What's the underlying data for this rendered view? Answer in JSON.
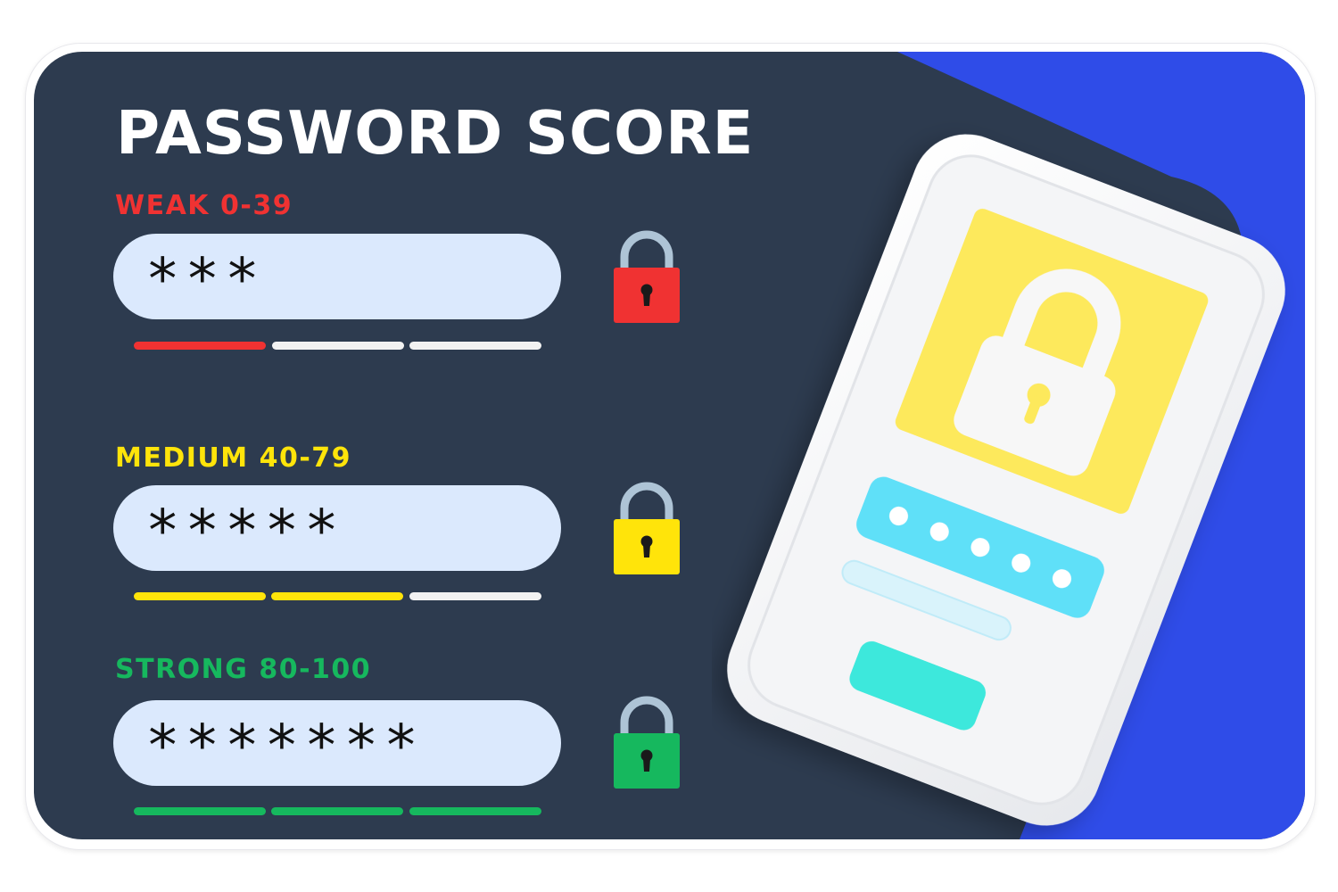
{
  "title": "PASSWORD SCORE",
  "colors": {
    "background": "#2d3b4f",
    "accent_blue": "#2f4ce8",
    "weak": "#f03232",
    "medium": "#ffe40a",
    "strong": "#16b85e",
    "field": "#dbe9fd",
    "meter_empty": "#f2f2f2",
    "lock_shackle": "#aec4d6"
  },
  "levels": [
    {
      "id": "weak",
      "label": "WEAK 0-39",
      "password": "***",
      "filled_segments": 1,
      "total_segments": 3,
      "color": "#f03232",
      "icon": "red-padlock-icon"
    },
    {
      "id": "medium",
      "label": "MEDIUM 40-79",
      "password": "*****",
      "filled_segments": 2,
      "total_segments": 3,
      "color": "#ffe40a",
      "icon": "yellow-padlock-icon"
    },
    {
      "id": "strong",
      "label": "STRONG 80-100",
      "password": "*******",
      "filled_segments": 3,
      "total_segments": 3,
      "color": "#16b85e",
      "icon": "green-padlock-icon"
    }
  ],
  "illustration": {
    "icon": "phone-lock-screen-icon",
    "masked_dots": 5,
    "padlock_color": "#fde95b",
    "field_color": "#5fe0f8",
    "button_color": "#3ce8dc"
  }
}
